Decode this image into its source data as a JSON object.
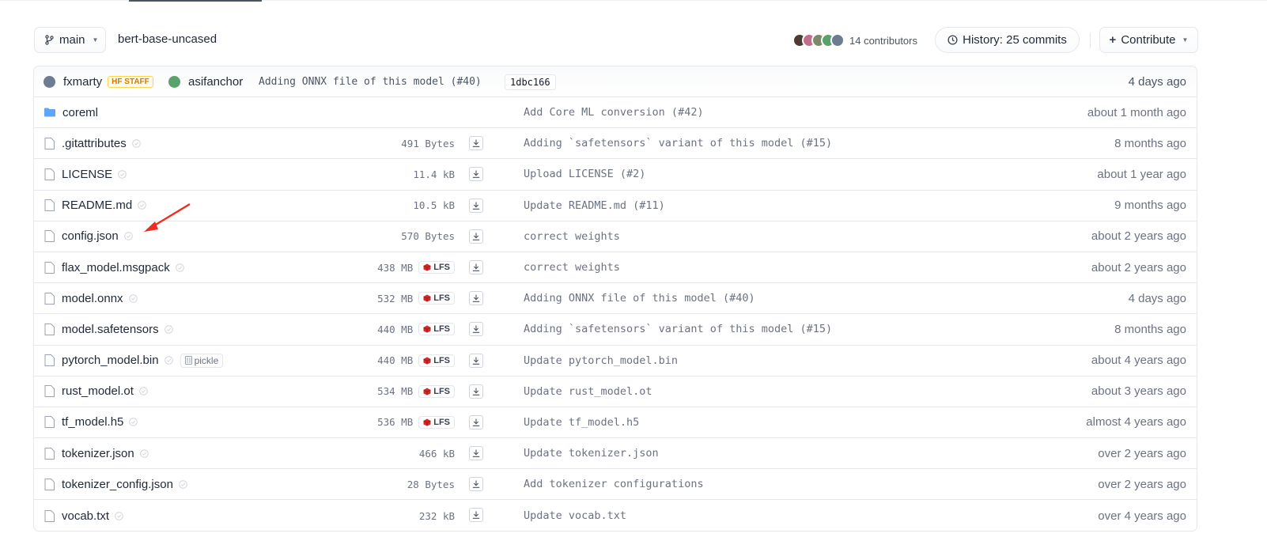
{
  "toolbar": {
    "branch": "main",
    "repo_name": "bert-base-uncased",
    "contributors_label": "14 contributors",
    "history_label": "History: 25 commits",
    "contribute_label": "Contribute"
  },
  "commit": {
    "author1": "fxmarty",
    "author1_badge": "HF STAFF",
    "author2": "asifanchor",
    "message": "Adding ONNX file of this model (#40)",
    "hash": "1dbc166",
    "date": "4 days ago"
  },
  "files": [
    {
      "name": "coreml",
      "type": "folder",
      "message": "Add Core ML conversion (#42)",
      "date": "about 1 month ago"
    },
    {
      "name": ".gitattributes",
      "type": "file",
      "size": "491 Bytes",
      "message": "Adding `safetensors` variant of this model (#15)",
      "date": "8 months ago"
    },
    {
      "name": "LICENSE",
      "type": "file",
      "size": "11.4 kB",
      "message": "Upload LICENSE (#2)",
      "date": "about 1 year ago"
    },
    {
      "name": "README.md",
      "type": "file",
      "size": "10.5 kB",
      "message": "Update README.md (#11)",
      "date": "9 months ago"
    },
    {
      "name": "config.json",
      "type": "file",
      "size": "570 Bytes",
      "message": "correct weights",
      "date": "about 2 years ago"
    },
    {
      "name": "flax_model.msgpack",
      "type": "file",
      "size": "438 MB",
      "lfs": "LFS",
      "message": "correct weights",
      "date": "about 2 years ago"
    },
    {
      "name": "model.onnx",
      "type": "file",
      "size": "532 MB",
      "lfs": "LFS",
      "message": "Adding ONNX file of this model (#40)",
      "date": "4 days ago"
    },
    {
      "name": "model.safetensors",
      "type": "file",
      "size": "440 MB",
      "lfs": "LFS",
      "message": "Adding `safetensors` variant of this model (#15)",
      "date": "8 months ago"
    },
    {
      "name": "pytorch_model.bin",
      "type": "file",
      "pickle": "pickle",
      "size": "440 MB",
      "lfs": "LFS",
      "message": "Update pytorch_model.bin",
      "date": "about 4 years ago"
    },
    {
      "name": "rust_model.ot",
      "type": "file",
      "size": "534 MB",
      "lfs": "LFS",
      "message": "Update rust_model.ot",
      "date": "about 3 years ago"
    },
    {
      "name": "tf_model.h5",
      "type": "file",
      "size": "536 MB",
      "lfs": "LFS",
      "message": "Update tf_model.h5",
      "date": "almost 4 years ago"
    },
    {
      "name": "tokenizer.json",
      "type": "file",
      "size": "466 kB",
      "message": "Update tokenizer.json",
      "date": "over 2 years ago"
    },
    {
      "name": "tokenizer_config.json",
      "type": "file",
      "size": "28 Bytes",
      "message": "Add tokenizer configurations",
      "date": "over 2 years ago"
    },
    {
      "name": "vocab.txt",
      "type": "file",
      "size": "232 kB",
      "message": "Update vocab.txt",
      "date": "over 4 years ago"
    }
  ],
  "colors": {
    "folder": "#60a5fa",
    "lfs_icon": "#dc2626",
    "annotation_arrow": "#ef2b22",
    "staff_badge": "#d97706"
  }
}
